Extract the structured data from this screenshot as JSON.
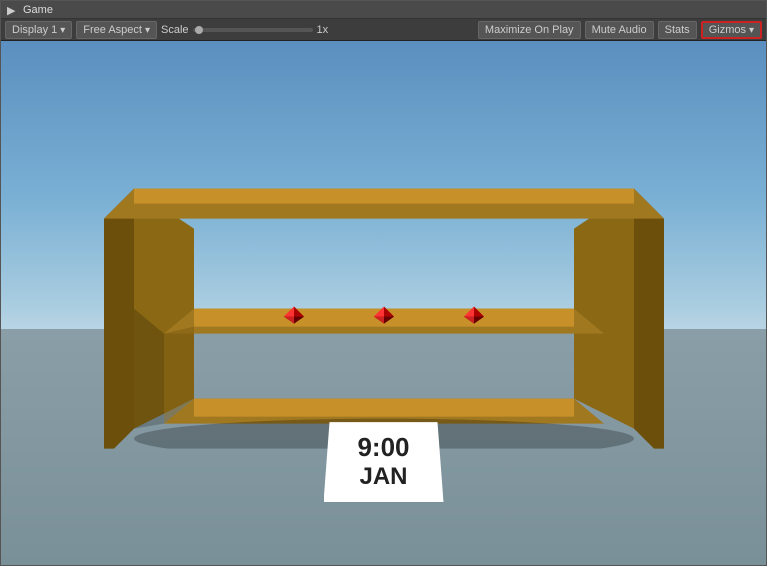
{
  "window": {
    "title": "Game",
    "icon": "▶"
  },
  "toolbar": {
    "display_label": "Display 1",
    "aspect_label": "Free Aspect",
    "scale_label": "Scale",
    "scale_value": "1x",
    "maximize_label": "Maximize On Play",
    "mute_label": "Mute Audio",
    "stats_label": "Stats",
    "gizmos_label": "Gizmos"
  },
  "viewport": {
    "time": "9:00",
    "month": "JAN"
  },
  "colors": {
    "gizmos_border": "#cc2222",
    "toolbar_bg": "#3d3d3d",
    "window_bg": "#4a4a4a"
  }
}
